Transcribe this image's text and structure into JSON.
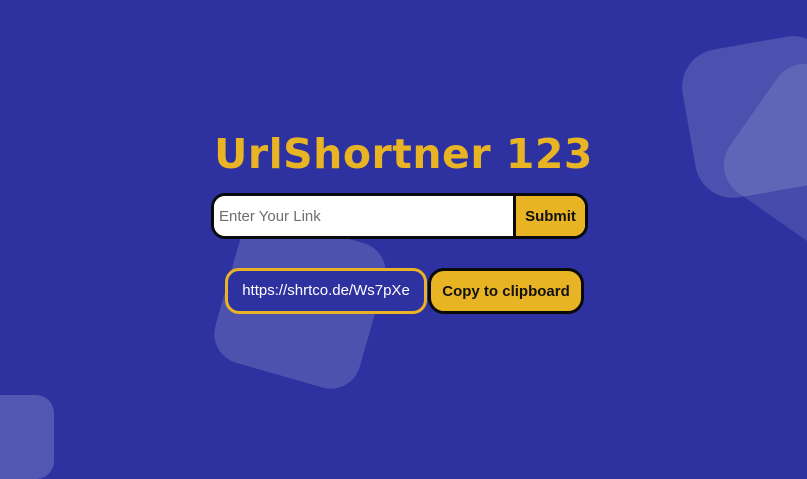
{
  "app": {
    "title": "UrlShortner 123"
  },
  "form": {
    "input_placeholder": "Enter Your Link",
    "input_value": "",
    "submit_label": "Submit"
  },
  "result": {
    "short_url": "https://shrtco.de/Ws7pXe",
    "copy_label": "Copy to clipboard"
  },
  "colors": {
    "background": "#2d32a0",
    "accent": "#e9b423",
    "border": "#0a0a0a",
    "input_background": "#ffffff"
  }
}
